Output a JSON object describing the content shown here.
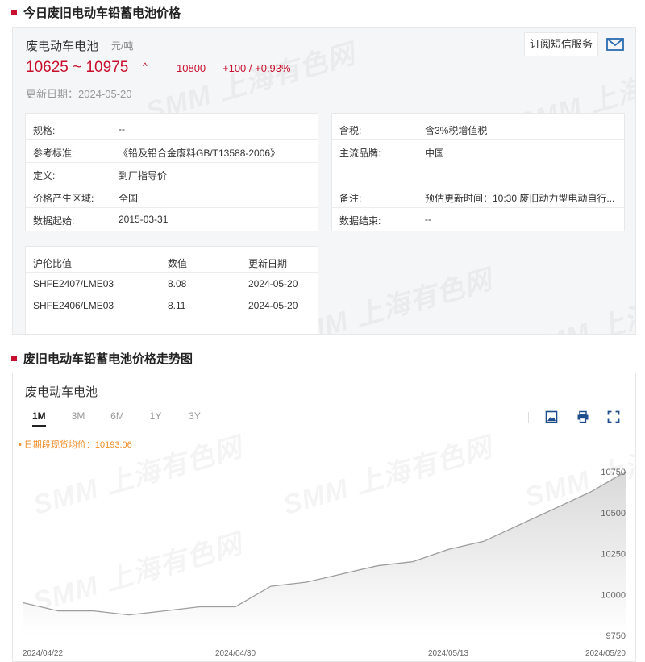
{
  "section1": {
    "title": "今日废旧电动车铅蓄电池价格"
  },
  "price": {
    "product": "废电动车电池",
    "unit": "元/吨",
    "range": "10625 ~ 10975",
    "arrow": "^",
    "avg": "10800",
    "change": "+100 / +0.93%",
    "update_label": "更新日期：",
    "update_date": "2024-05-20",
    "subscribe_label": "订阅短信服务",
    "mail_icon": "mail-icon",
    "accent": "#c8102e"
  },
  "watermark": "SMM 上海有色网",
  "spec_left": [
    {
      "k": "规格:",
      "v": "--"
    },
    {
      "k": "参考标准:",
      "v": "《铅及铅合金废料GB/T13588-2006》"
    },
    {
      "k": "定义:",
      "v": "到厂指导价"
    },
    {
      "k": "价格产生区域:",
      "v": "全国"
    },
    {
      "k": "数据起始:",
      "v": "2015-03-31"
    }
  ],
  "spec_right": [
    {
      "k": "含税:",
      "v": "含3%税增值税"
    },
    {
      "k": "主流品牌:",
      "v": "中国"
    },
    {
      "k": "",
      "v": ""
    },
    {
      "k": "备注:",
      "v": "预估更新时间：10:30 废旧动力型电动自行..."
    },
    {
      "k": "数据结束:",
      "v": "--"
    }
  ],
  "ratio": {
    "headers": [
      "沪伦比值",
      "数值",
      "更新日期"
    ],
    "rows": [
      [
        "SHFE2407/LME03",
        "8.08",
        "2024-05-20"
      ],
      [
        "SHFE2406/LME03",
        "8.11",
        "2024-05-20"
      ]
    ]
  },
  "section2": {
    "title": "废旧电动车铅蓄电池价格走势图"
  },
  "chart_panel": {
    "name": "废电动车电池",
    "ranges": [
      "1M",
      "3M",
      "6M",
      "1Y",
      "3Y"
    ],
    "active_range": "1M",
    "avg_note": "• 日期段现货均价：10193.06",
    "tools": [
      "download-icon",
      "print-icon",
      "fullscreen-icon"
    ]
  },
  "chart_data": {
    "type": "area",
    "title": "",
    "xlabel": "",
    "ylabel": "",
    "x": [
      "2024/04/22",
      "2024/04/23",
      "2024/04/24",
      "2024/04/25",
      "2024/04/26",
      "2024/04/29",
      "2024/04/30",
      "2024/05/06",
      "2024/05/07",
      "2024/05/08",
      "2024/05/09",
      "2024/05/10",
      "2024/05/13",
      "2024/05/14",
      "2024/05/15",
      "2024/05/16",
      "2024/05/17",
      "2024/05/20"
    ],
    "values": [
      9950,
      9900,
      9900,
      9875,
      9900,
      9925,
      9925,
      10050,
      10075,
      10125,
      10175,
      10200,
      10275,
      10325,
      10425,
      10525,
      10625,
      10750
    ],
    "x_tick_labels": [
      "2024/04/22",
      "2024/04/30",
      "2024/05/13",
      "2024/05/20"
    ],
    "y_ticks": [
      9750,
      10000,
      10250,
      10500,
      10750
    ],
    "ylim": [
      9750,
      10750
    ],
    "grid": false,
    "line_color": "#9e9e9e",
    "fill_color": "#d9d9d9"
  }
}
